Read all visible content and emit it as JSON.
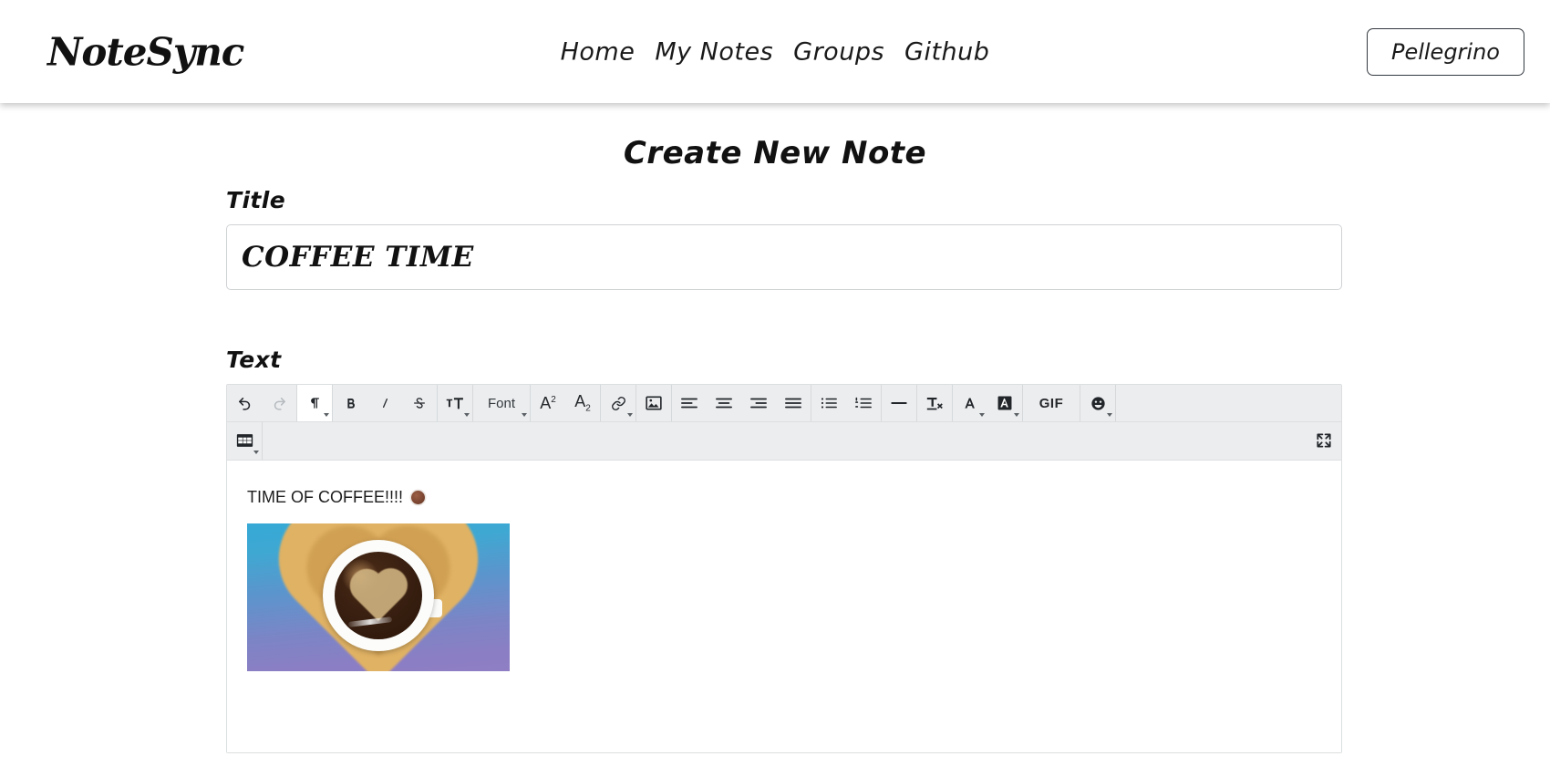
{
  "header": {
    "brand": "NoteSync",
    "nav": [
      {
        "label": "Home"
      },
      {
        "label": "My Notes"
      },
      {
        "label": "Groups"
      },
      {
        "label": "Github"
      }
    ],
    "user_button": "Pellegrino"
  },
  "main": {
    "page_title": "Create New Note",
    "title_field": {
      "label": "Title",
      "value": "COFFEE TIME",
      "placeholder": ""
    },
    "text_field": {
      "label": "Text"
    }
  },
  "editor": {
    "toolbar_rows": [
      {
        "groups": [
          {
            "items": [
              {
                "name": "undo-icon",
                "icon": "undo",
                "label": "",
                "state": "enabled",
                "caret": false
              },
              {
                "name": "redo-icon",
                "icon": "redo",
                "label": "",
                "state": "disabled",
                "caret": false
              }
            ]
          },
          {
            "items": [
              {
                "name": "paragraph-style-button",
                "icon": "pilcrow",
                "label": "",
                "state": "active",
                "caret": true
              }
            ]
          },
          {
            "items": [
              {
                "name": "bold-button",
                "icon": "bold",
                "label": "B",
                "state": "enabled",
                "caret": false
              },
              {
                "name": "italic-button",
                "icon": "italic",
                "label": "I",
                "state": "enabled",
                "caret": false
              },
              {
                "name": "strikethrough-button",
                "icon": "strikethrough",
                "label": "S",
                "state": "enabled",
                "caret": false
              }
            ]
          },
          {
            "items": [
              {
                "name": "font-size-button",
                "icon": "font-size",
                "label": "",
                "state": "enabled",
                "caret": true
              }
            ]
          },
          {
            "items": [
              {
                "name": "font-family-button",
                "icon": "text-label",
                "label": "Font",
                "state": "enabled",
                "caret": true
              }
            ]
          },
          {
            "items": [
              {
                "name": "superscript-button",
                "icon": "superscript",
                "label": "",
                "state": "enabled",
                "caret": false
              },
              {
                "name": "subscript-button",
                "icon": "subscript",
                "label": "",
                "state": "enabled",
                "caret": false
              }
            ]
          },
          {
            "items": [
              {
                "name": "link-button",
                "icon": "link",
                "label": "",
                "state": "enabled",
                "caret": true
              }
            ]
          },
          {
            "items": [
              {
                "name": "insert-image-button",
                "icon": "image",
                "label": "",
                "state": "enabled",
                "caret": false
              }
            ]
          },
          {
            "items": [
              {
                "name": "align-left-button",
                "icon": "align-left",
                "label": "",
                "state": "enabled",
                "caret": false
              },
              {
                "name": "align-center-button",
                "icon": "align-center",
                "label": "",
                "state": "enabled",
                "caret": false
              },
              {
                "name": "align-right-button",
                "icon": "align-right",
                "label": "",
                "state": "enabled",
                "caret": false
              },
              {
                "name": "align-justify-button",
                "icon": "align-justify",
                "label": "",
                "state": "enabled",
                "caret": false
              }
            ]
          },
          {
            "items": [
              {
                "name": "unordered-list-button",
                "icon": "bullet-list",
                "label": "",
                "state": "enabled",
                "caret": false
              },
              {
                "name": "ordered-list-button",
                "icon": "numbered-list",
                "label": "",
                "state": "enabled",
                "caret": false
              }
            ]
          },
          {
            "items": [
              {
                "name": "horizontal-rule-button",
                "icon": "horizontal-rule",
                "label": "",
                "state": "enabled",
                "caret": false
              }
            ]
          },
          {
            "items": [
              {
                "name": "clear-formatting-button",
                "icon": "clear-format",
                "label": "",
                "state": "enabled",
                "caret": false
              }
            ]
          },
          {
            "items": [
              {
                "name": "text-color-button",
                "icon": "text-color",
                "label": "",
                "state": "enabled",
                "caret": true
              },
              {
                "name": "highlight-color-button",
                "icon": "highlight-color",
                "label": "",
                "state": "enabled",
                "caret": true
              }
            ]
          },
          {
            "items": [
              {
                "name": "insert-gif-button",
                "icon": "gif",
                "label": "GIF",
                "state": "enabled",
                "caret": false
              }
            ]
          },
          {
            "items": [
              {
                "name": "emoji-button",
                "icon": "emoji",
                "label": "",
                "state": "enabled",
                "caret": true
              }
            ]
          }
        ]
      },
      {
        "groups": [
          {
            "items": [
              {
                "name": "insert-table-button",
                "icon": "table",
                "label": "",
                "state": "enabled",
                "caret": true
              }
            ]
          }
        ],
        "right_items": [
          {
            "name": "fullscreen-button",
            "icon": "fullscreen",
            "label": "",
            "state": "enabled",
            "caret": false
          }
        ]
      }
    ],
    "content": {
      "paragraph_text": "TIME OF COFFEE!!!!",
      "emoji_name": "coffee-emoji",
      "image_alt": "coffee-cup-heart-latte-art-image"
    }
  },
  "colors": {
    "toolbar_bg": "#ecedef",
    "toolbar_border": "#dcdfe0",
    "active_button_bg": "#ffffff",
    "icon": "#22262a",
    "icon_disabled": "#b6bbbf",
    "text": "#111111",
    "input_border": "#cfd2d4",
    "page_bg": "#ffffff"
  }
}
